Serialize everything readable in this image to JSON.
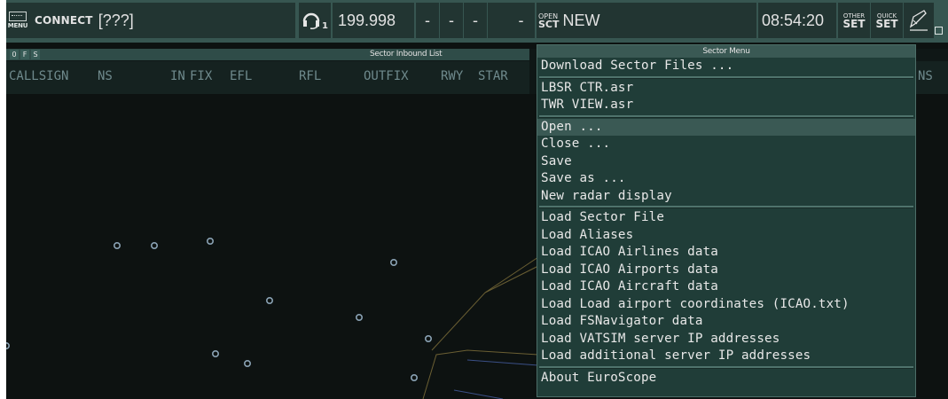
{
  "toolbar": {
    "menu_label": "MENU",
    "connect_label": "CONNECT",
    "connect_status": "[???]",
    "headset_index": "1",
    "frequency": "199.998",
    "dashes": [
      "-",
      "-",
      "-",
      "-"
    ],
    "open_sct_top": "OPEN",
    "open_sct_bottom": "SCT",
    "sector_name": "NEW",
    "clock": "08:54:20",
    "other_set_top": "OTHER",
    "other_set_bottom": "SET",
    "quick_set_top": "QUICK",
    "quick_set_bottom": "SET"
  },
  "inbound_list": {
    "flags": [
      "0",
      "F",
      "S"
    ],
    "title": "Sector Inbound List",
    "columns": [
      "CALLSIGN",
      "NS",
      "IN",
      "FIX",
      "EFL",
      "RFL",
      "OUTFIX",
      "RWY",
      "STAR"
    ],
    "right_column": "NS"
  },
  "sector_menu": {
    "title": "Sector Menu",
    "groups": [
      [
        "Download Sector Files ..."
      ],
      [
        "LBSR CTR.asr",
        "TWR VIEW.asr"
      ],
      [
        "Open ...",
        "Close ...",
        "Save",
        "Save as ...",
        "New radar display"
      ],
      [
        "Load Sector File",
        "Load Aliases",
        "Load ICAO Airlines data",
        "Load ICAO Airports data",
        "Load ICAO Aircraft data",
        "Load Load airport coordinates (ICAO.txt)",
        "Load FSNavigator data",
        "Load VATSIM server IP addresses",
        "Load additional server IP addresses"
      ],
      [
        "About EuroScope"
      ]
    ],
    "highlighted": "Open ..."
  },
  "colors": {
    "toolbar_bg": "#375651",
    "button_bg": "#223532",
    "radar_bg": "#0d1211",
    "menu_bg": "#203d38",
    "menu_highlight": "#3a5954",
    "column_text": "#6f8a8d",
    "fix_symbol": "#8aa2b4"
  }
}
